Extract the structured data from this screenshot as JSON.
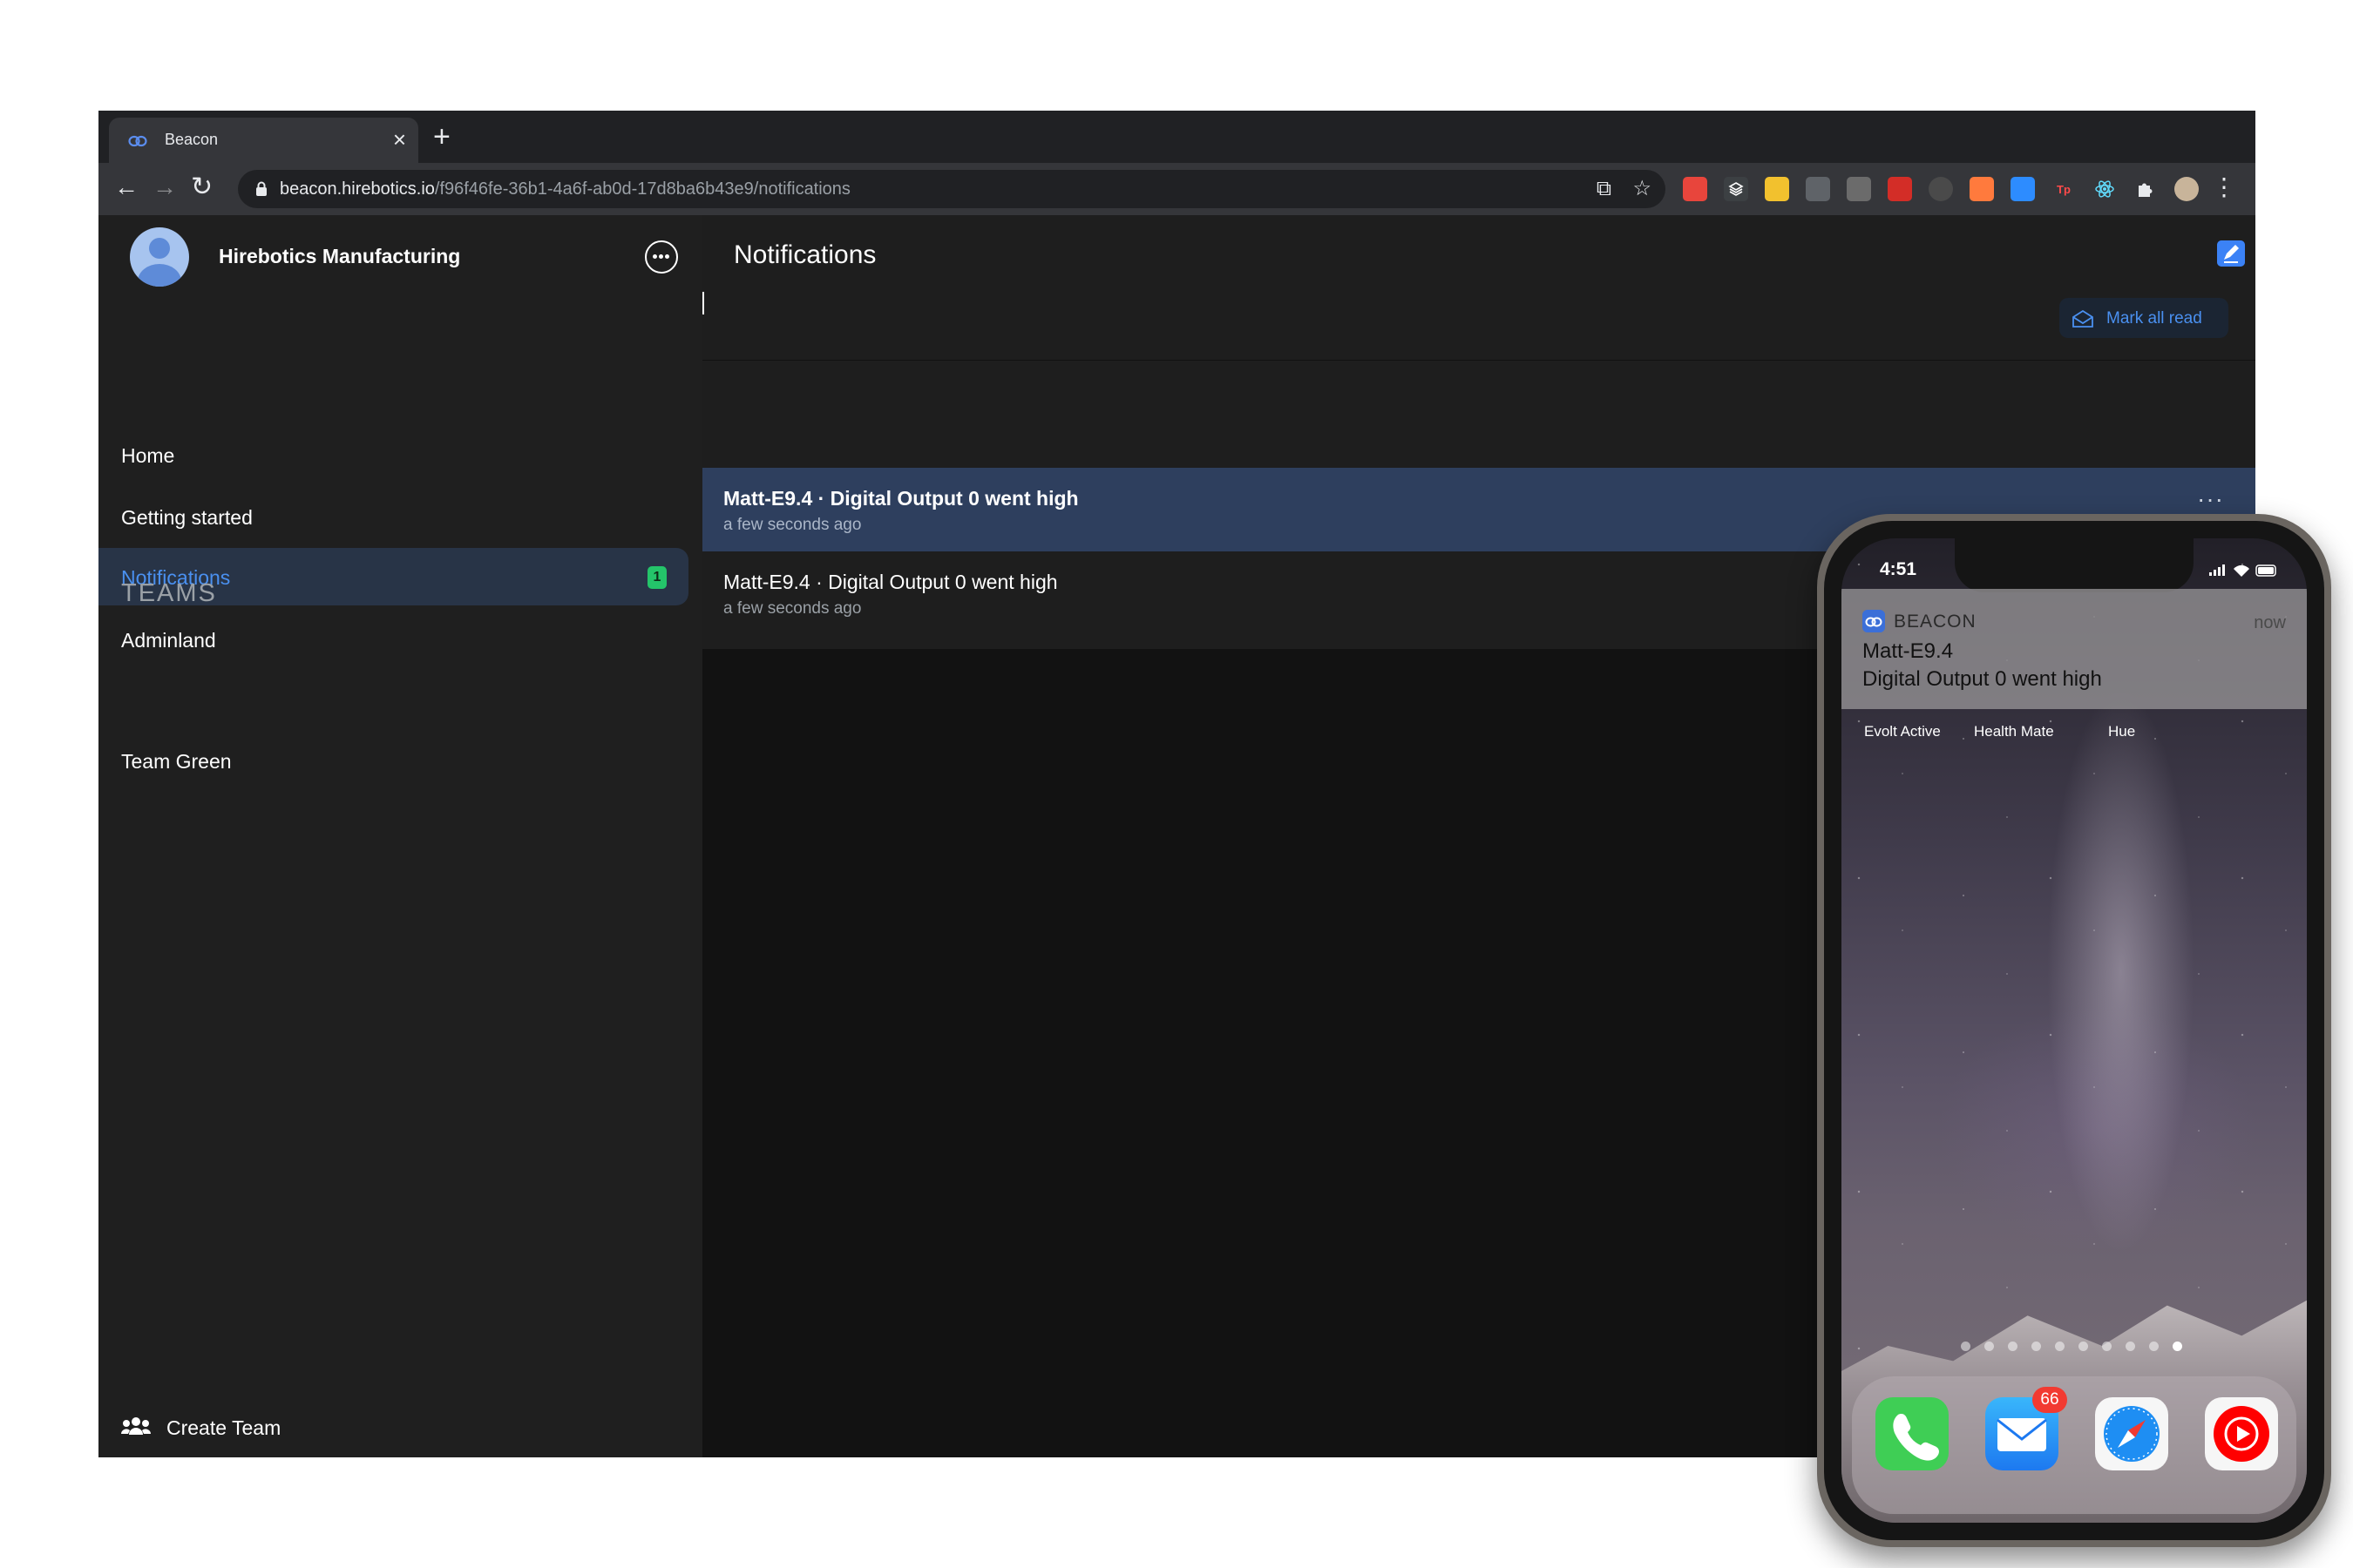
{
  "browser": {
    "tab": {
      "title": "Beacon",
      "close": "×"
    },
    "new_tab": "+",
    "nav": {
      "back": "←",
      "forward": "→",
      "reload": "↻"
    },
    "url": {
      "host": "beacon.hirebotics.io",
      "path": "/f96f46fe-36b1-4a6f-ab0d-17d8ba6b43e9/notifications"
    },
    "omnibox_icons": {
      "open_external": "⧉",
      "bookmark": "☆"
    },
    "extensions": [
      {
        "name": "reader-extension-icon",
        "color": "#e8453c"
      },
      {
        "name": "buffer-extension-icon",
        "color": "#3c4043"
      },
      {
        "name": "sticky-note-extension-icon",
        "color": "#f2c12e"
      },
      {
        "name": "drive-extension-icon",
        "color": "#5f6368"
      },
      {
        "name": "grammar-extension-icon",
        "color": "#6b6b6b"
      },
      {
        "name": "lastpass-extension-icon",
        "color": "#d32d27"
      },
      {
        "name": "privacy-extension-icon",
        "color": "#4a4a4a"
      },
      {
        "name": "hubspot-extension-icon",
        "color": "#ff7a3d"
      },
      {
        "name": "zoom-extension-icon",
        "color": "#2d8cff"
      },
      {
        "name": "tp-extension-icon",
        "color": "#35363a",
        "text": "Tp"
      },
      {
        "name": "react-devtools-extension-icon",
        "color": "#35363a"
      },
      {
        "name": "extensions-puzzle-icon",
        "color": "#35363a"
      },
      {
        "name": "profile-avatar-icon",
        "color": "#c8b49a"
      }
    ],
    "menu": "⋮"
  },
  "sidebar": {
    "org_name": "Hirebotics Manufacturing",
    "items": [
      {
        "label": "Home"
      },
      {
        "label": "Getting started"
      },
      {
        "label": "Notifications",
        "badge": "1"
      },
      {
        "label": "Adminland"
      }
    ],
    "teams_heading": "TEAMS",
    "teams": [
      {
        "label": "Team Green"
      }
    ],
    "create_team": "Create Team"
  },
  "main": {
    "title": "Notifications",
    "mark_all_read": "Mark all read",
    "notifications": [
      {
        "title": "Matt-E9.4 · Digital Output 0 went high",
        "time": "a few seconds ago",
        "unread": true,
        "more": "···"
      },
      {
        "title": "Matt-E9.4 · Digital Output 0 went high",
        "time": "a few seconds ago",
        "unread": false
      }
    ]
  },
  "phone": {
    "time": "4:51",
    "notification": {
      "app": "BEACON",
      "time": "now",
      "title": "Matt-E9.4",
      "body": "Digital Output 0 went high"
    },
    "app_labels": [
      "Evolt Active",
      "Health Mate",
      "Hue"
    ],
    "page_dots": 10,
    "active_page": 10,
    "dock": [
      {
        "name": "phone-app-icon"
      },
      {
        "name": "mail-app-icon",
        "badge": "66"
      },
      {
        "name": "safari-app-icon"
      },
      {
        "name": "youtube-music-app-icon"
      }
    ]
  },
  "colors": {
    "accent": "#4a90f0",
    "badge_green": "#24c46a",
    "unread_row": "#2e3f5e",
    "sidebar_bg": "#1f1f1f"
  }
}
